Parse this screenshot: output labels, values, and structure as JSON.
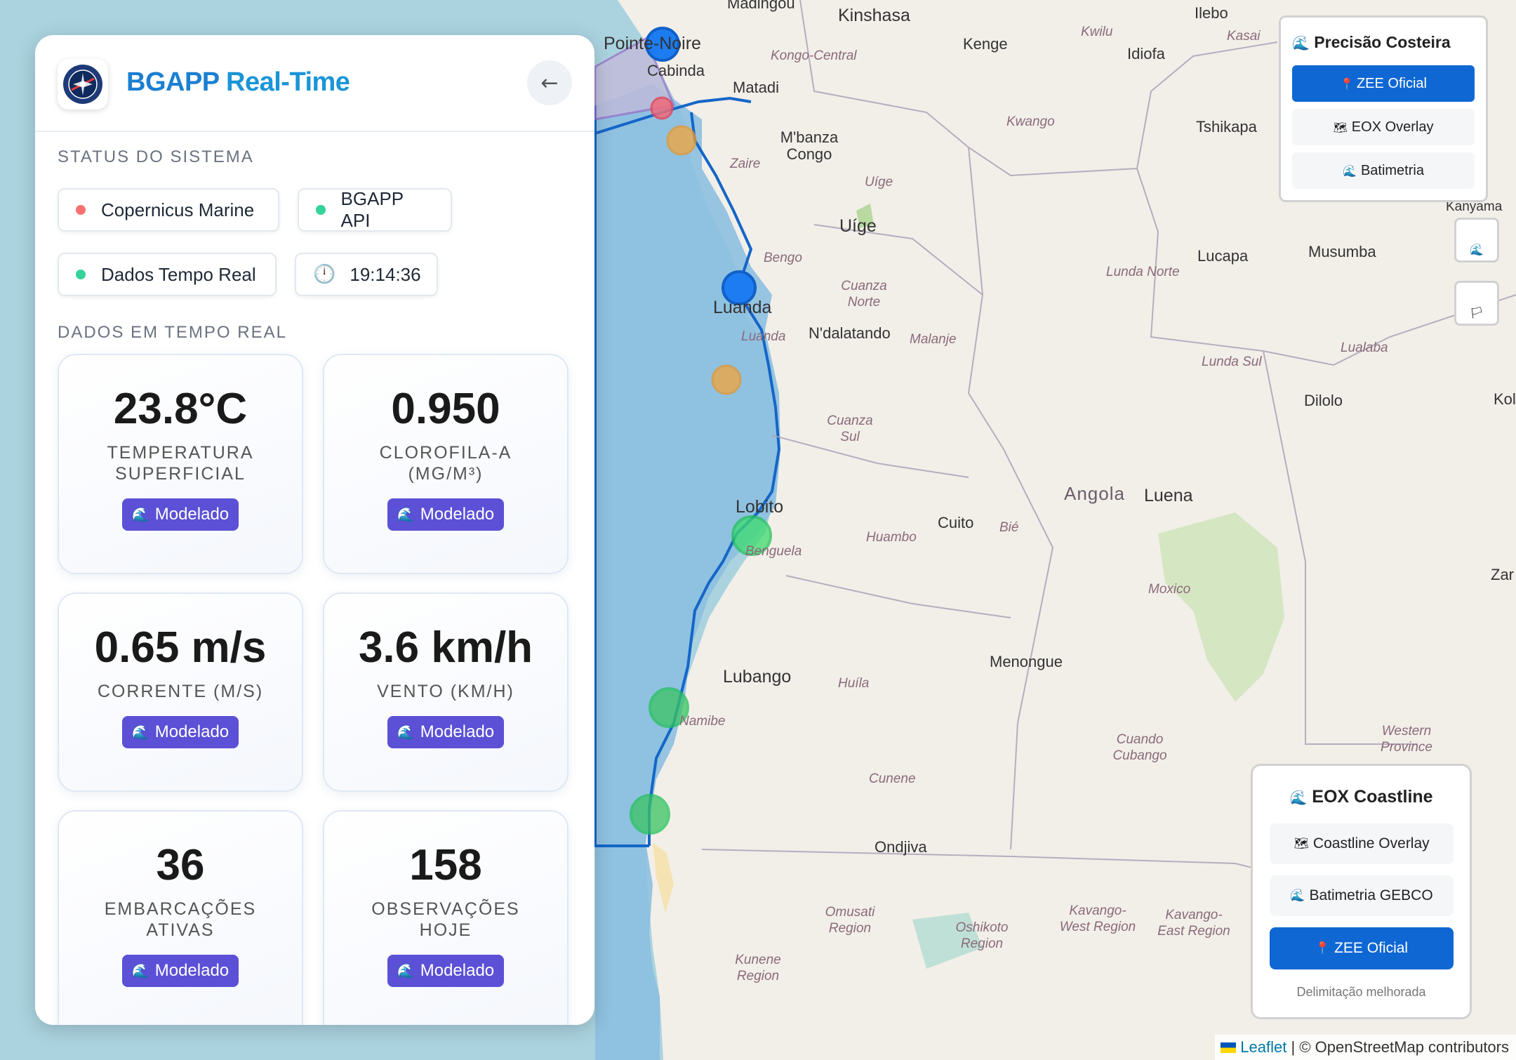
{
  "panel": {
    "title_part1": "BGAPP",
    "title_part2": "Real-Time",
    "collapse_icon": "←",
    "status_title": "STATUS DO SISTEMA",
    "status": [
      {
        "label": "Copernicus Marine",
        "color": "#f87171"
      },
      {
        "label": "BGAPP API",
        "color": "#34d399"
      },
      {
        "label": "Dados Tempo Real",
        "color": "#34d399"
      }
    ],
    "time": "19:14:36",
    "realtime_title": "DADOS EM TEMPO REAL",
    "badge_label": "Modelado",
    "cards": [
      {
        "value": "23.8°C",
        "label": "TEMPERATURA SUPERFICIAL"
      },
      {
        "value": "0.950",
        "label": "CLOROFILA-A (MG/M³)"
      },
      {
        "value": "0.65 m/s",
        "label": "CORRENTE (M/S)"
      },
      {
        "value": "3.6 km/h",
        "label": "VENTO (KM/H)"
      },
      {
        "value": "36",
        "label": "EMBARCAÇÕES ATIVAS"
      },
      {
        "value": "158",
        "label": "OBSERVAÇÕES HOJE"
      }
    ]
  },
  "precision": {
    "title": "Precisão Costeira",
    "buttons": [
      {
        "label": "ZEE Oficial",
        "icon": "📍",
        "active": true
      },
      {
        "label": "EOX Overlay",
        "icon": "🗺",
        "active": false
      },
      {
        "label": "Batimetria",
        "icon": "🌊",
        "active": false
      }
    ]
  },
  "eox": {
    "title": "EOX Coastline",
    "buttons": [
      {
        "label": "Coastline Overlay",
        "icon": "🗺",
        "active": false
      },
      {
        "label": "Batimetria GEBCO",
        "icon": "🌊",
        "active": false
      },
      {
        "label": "ZEE Oficial",
        "icon": "📍",
        "active": true
      }
    ],
    "note": "Delimitação melhorada"
  },
  "attribution": {
    "leaflet": "Leaflet",
    "osm": "| © OpenStreetMap contributors"
  },
  "map_labels": [
    {
      "text": "Madingou",
      "cls": "city"
    },
    {
      "text": "Kinshasa",
      "cls": "bigcity"
    },
    {
      "text": "Ilebo",
      "cls": "city"
    },
    {
      "text": "Kwilu",
      "cls": "region"
    },
    {
      "text": "Kasai",
      "cls": "region"
    },
    {
      "text": "Kenge",
      "cls": "city"
    },
    {
      "text": "Idiofa",
      "cls": "city"
    },
    {
      "text": "Pointe-Noire",
      "cls": "bigcity"
    },
    {
      "text": "Cabinda",
      "cls": "city"
    },
    {
      "text": "Kongo-Central",
      "cls": "region"
    },
    {
      "text": "Matadi",
      "cls": "city"
    },
    {
      "text": "Kwango",
      "cls": "region"
    },
    {
      "text": "Tshikapa",
      "cls": "city"
    },
    {
      "text": "M'banza Congo",
      "cls": "city"
    },
    {
      "text": "Zaire",
      "cls": "region"
    },
    {
      "text": "Uíge",
      "cls": "region"
    },
    {
      "text": "Uíge",
      "cls": "bigcity"
    },
    {
      "text": "Kanyama",
      "cls": "city"
    },
    {
      "text": "Bengo",
      "cls": "region"
    },
    {
      "text": "Lucapa",
      "cls": "city"
    },
    {
      "text": "Musumba",
      "cls": "city"
    },
    {
      "text": "Lunda Norte",
      "cls": "region"
    },
    {
      "text": "Luanda",
      "cls": "bigcity"
    },
    {
      "text": "Cuanza Norte",
      "cls": "region"
    },
    {
      "text": "N'dalatando",
      "cls": "city"
    },
    {
      "text": "Malanje",
      "cls": "region"
    },
    {
      "text": "Luanda",
      "cls": "region"
    },
    {
      "text": "Lualaba",
      "cls": "region"
    },
    {
      "text": "Lunda Sul",
      "cls": "region"
    },
    {
      "text": "Dilolo",
      "cls": "city"
    },
    {
      "text": "Kol",
      "cls": "city"
    },
    {
      "text": "Cuanza Sul",
      "cls": "region"
    },
    {
      "text": "Lobito",
      "cls": "bigcity"
    },
    {
      "text": "Angola",
      "cls": "country"
    },
    {
      "text": "Luena",
      "cls": "bigcity"
    },
    {
      "text": "Cuito",
      "cls": "city"
    },
    {
      "text": "Bié",
      "cls": "region"
    },
    {
      "text": "Huambo",
      "cls": "region"
    },
    {
      "text": "Benguela",
      "cls": "region"
    },
    {
      "text": "Moxico",
      "cls": "region"
    },
    {
      "text": "Zar",
      "cls": "city"
    },
    {
      "text": "Lubango",
      "cls": "bigcity"
    },
    {
      "text": "Huíla",
      "cls": "region"
    },
    {
      "text": "Menongue",
      "cls": "city"
    },
    {
      "text": "Namibe",
      "cls": "region"
    },
    {
      "text": "Cuando Cubango",
      "cls": "region"
    },
    {
      "text": "Western Province",
      "cls": "region"
    },
    {
      "text": "Cunene",
      "cls": "region"
    },
    {
      "text": "Ondjiva",
      "cls": "city"
    },
    {
      "text": "Omusati Region",
      "cls": "region"
    },
    {
      "text": "Oshikoto Region",
      "cls": "region"
    },
    {
      "text": "Kavango-West Region",
      "cls": "region"
    },
    {
      "text": "Kavango-East Region",
      "cls": "region"
    },
    {
      "text": "Kunene Region",
      "cls": "region"
    }
  ]
}
